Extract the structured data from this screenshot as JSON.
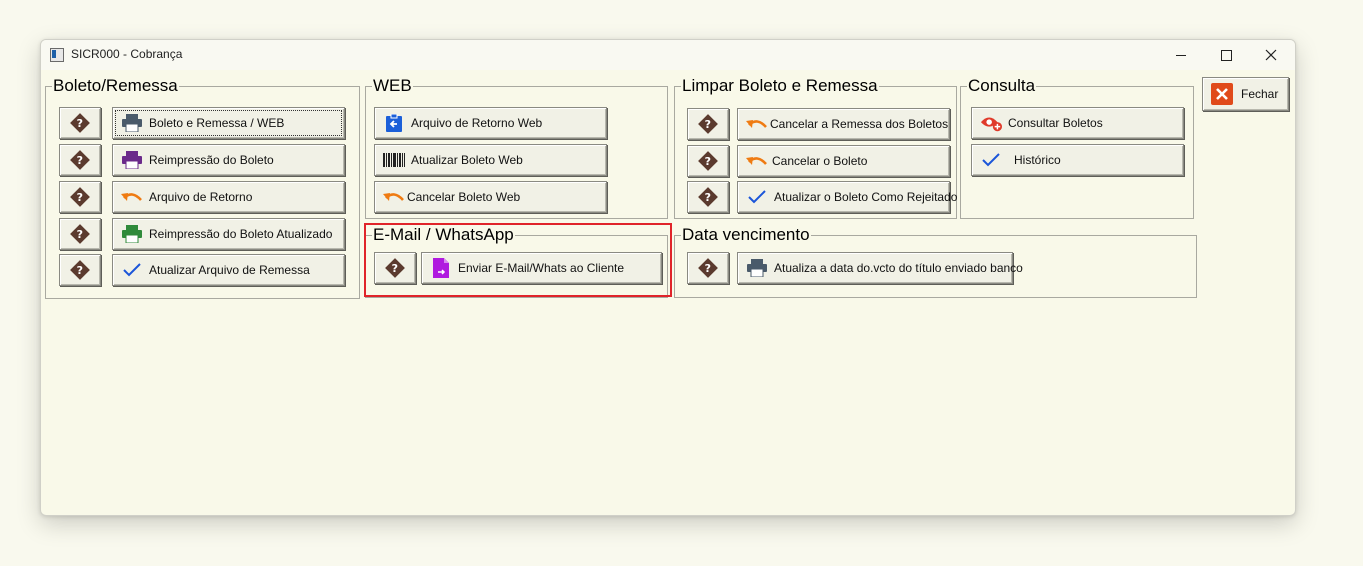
{
  "window": {
    "title": "SICR000 - Cobrança",
    "controls": {
      "minimize": "minimize",
      "maximize": "maximize",
      "close": "close"
    }
  },
  "groups": {
    "boleto": {
      "title": "Boleto/Remessa",
      "buttons": [
        {
          "label": "Boleto e Remessa  / WEB",
          "icon": "printer-icon",
          "color": "#4a5a6a"
        },
        {
          "label": "Reimpressão do Boleto",
          "icon": "printer-icon",
          "color": "#6b2a8a"
        },
        {
          "label": "Arquivo de Retorno",
          "icon": "undo-arrow-icon",
          "color": "#ef7b12"
        },
        {
          "label": "Reimpressão do Boleto Atualizado",
          "icon": "printer-icon",
          "color": "#2f8a3a"
        },
        {
          "label": "Atualizar Arquivo de Remessa",
          "icon": "checkmark-icon",
          "color": "#1b55d9"
        }
      ]
    },
    "web": {
      "title": "WEB",
      "buttons": [
        {
          "label": "Arquivo de Retorno Web",
          "icon": "clipboard-arrow-icon",
          "color": "#1b5fd9"
        },
        {
          "label": "Atualizar Boleto Web",
          "icon": "barcode-icon",
          "color": "#222222"
        },
        {
          "label": "Cancelar Boleto Web",
          "icon": "undo-arrow-icon",
          "color": "#ef7b12"
        }
      ]
    },
    "limpar": {
      "title": "Limpar Boleto e Remessa",
      "buttons": [
        {
          "label": "Cancelar a Remessa dos Boletos",
          "icon": "undo-arrow-icon",
          "color": "#ef7b12"
        },
        {
          "label": "Cancelar o Boleto",
          "icon": "undo-arrow-icon",
          "color": "#ef7b12"
        },
        {
          "label": "Atualizar o Boleto Como Rejeitado",
          "icon": "checkmark-icon",
          "color": "#1b55d9"
        }
      ]
    },
    "consulta": {
      "title": "Consulta",
      "buttons": [
        {
          "label": "Consultar Boletos",
          "icon": "eye-plus-icon",
          "color": "#e03a2a"
        },
        {
          "label": "Histórico",
          "icon": "checkmark-icon",
          "color": "#1b55d9"
        }
      ]
    },
    "email": {
      "title": "E-Mail / WhatsApp",
      "buttons": [
        {
          "label": "Enviar E-Mail/Whats ao Cliente",
          "icon": "file-send-icon",
          "color": "#b01adf"
        }
      ]
    },
    "vencimento": {
      "title": "Data vencimento",
      "buttons": [
        {
          "label": "Atualiza a data do.vcto do título enviado banco",
          "icon": "printer-icon",
          "color": "#4a5a6a"
        }
      ]
    }
  },
  "fechar": {
    "label": "Fechar",
    "icon": "close-x-icon",
    "color": "#e04a1a"
  },
  "help_glyph": "?"
}
